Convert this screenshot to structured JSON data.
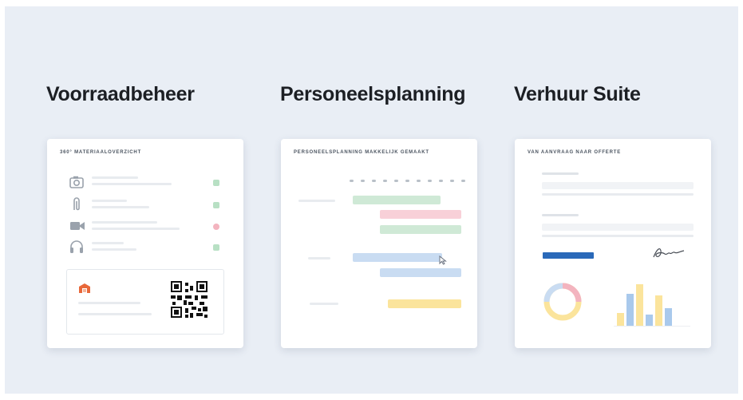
{
  "headings": [
    "Voorraadbeheer",
    "Personeelsplanning",
    "Verhuur Suite"
  ],
  "cards": [
    {
      "title": "360° MATERIAALOVERZICHT"
    },
    {
      "title": "PERSONEELSPLANNING MAKKELIJK GEMAAKT"
    },
    {
      "title": "VAN AANVRAAG NAAR OFFERTE"
    }
  ],
  "inventory_items": [
    {
      "icon": "camera-icon",
      "status": "ok"
    },
    {
      "icon": "paperclip-icon",
      "status": "ok"
    },
    {
      "icon": "video-camera-icon",
      "status": "alert"
    },
    {
      "icon": "headphones-icon",
      "status": "ok"
    }
  ],
  "colors": {
    "background": "#e9eef5",
    "green": "#cfe9d6",
    "pink": "#f8d0d8",
    "blue": "#c9dcf2",
    "yellow": "#fbe49c",
    "accent_blue": "#2a69b9",
    "warehouse": "#e8683a"
  },
  "icons": [
    "warehouse-icon",
    "qr-code-icon",
    "cursor-icon",
    "signature-icon",
    "donut-chart-icon",
    "bar-chart-icon"
  ]
}
